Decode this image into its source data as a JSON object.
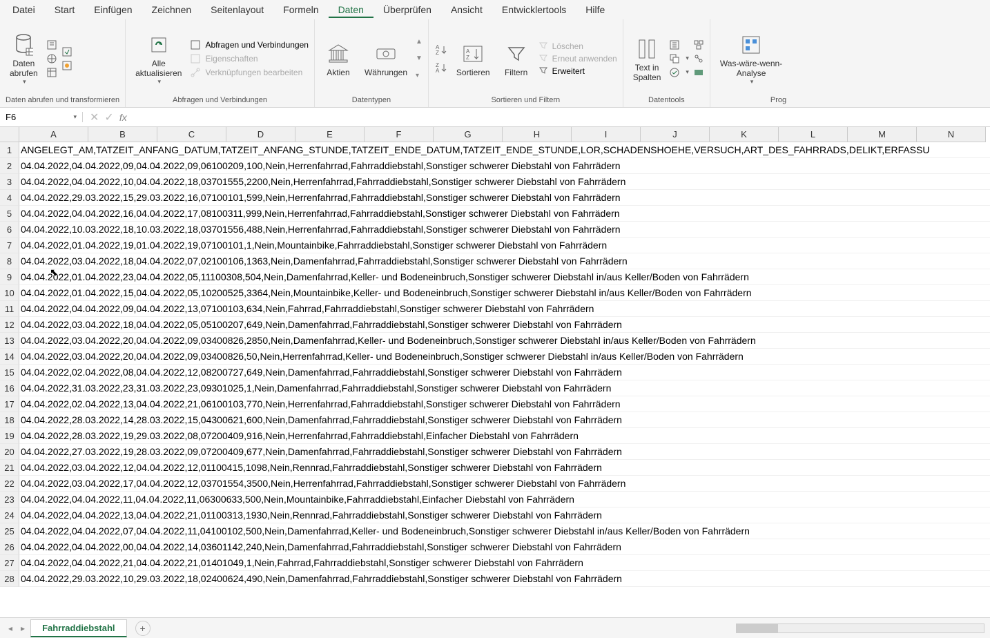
{
  "menu": {
    "items": [
      "Datei",
      "Start",
      "Einfügen",
      "Zeichnen",
      "Seitenlayout",
      "Formeln",
      "Daten",
      "Überprüfen",
      "Ansicht",
      "Entwicklertools",
      "Hilfe"
    ],
    "active_index": 6
  },
  "ribbon": {
    "groups": [
      {
        "name": "data-get-transform",
        "buttons": {
          "daten_abrufen": "Daten\nabrufen"
        },
        "label": "Daten abrufen und transformieren"
      },
      {
        "name": "queries-connections",
        "buttons": {
          "alle_aktualisieren": "Alle\naktualisieren",
          "abfragen": "Abfragen und Verbindungen",
          "eigenschaften": "Eigenschaften",
          "verknuepfungen": "Verknüpfungen bearbeiten"
        },
        "label": "Abfragen und Verbindungen"
      },
      {
        "name": "data-types",
        "buttons": {
          "aktien": "Aktien",
          "waehrungen": "Währungen"
        },
        "label": "Datentypen"
      },
      {
        "name": "sort-filter",
        "buttons": {
          "sortieren": "Sortieren",
          "filtern": "Filtern",
          "loeschen": "Löschen",
          "erneut": "Erneut anwenden",
          "erweitert": "Erweitert"
        },
        "label": "Sortieren und Filtern"
      },
      {
        "name": "data-tools",
        "buttons": {
          "text_in_spalten": "Text in\nSpalten"
        },
        "label": "Datentools"
      },
      {
        "name": "forecast",
        "buttons": {
          "was_waere": "Was-wäre-wenn-\nAnalyse"
        },
        "label": "Prog"
      }
    ]
  },
  "name_box": "F6",
  "formula": "",
  "columns": [
    "A",
    "B",
    "C",
    "D",
    "E",
    "F",
    "G",
    "H",
    "I",
    "J",
    "K",
    "L",
    "M",
    "N"
  ],
  "rows": [
    {
      "n": 1,
      "text": "ANGELEGT_AM,TATZEIT_ANFANG_DATUM,TATZEIT_ANFANG_STUNDE,TATZEIT_ENDE_DATUM,TATZEIT_ENDE_STUNDE,LOR,SCHADENSHOEHE,VERSUCH,ART_DES_FAHRRADS,DELIKT,ERFASSU"
    },
    {
      "n": 2,
      "text": "04.04.2022,04.04.2022,09,04.04.2022,09,06100209,100,Nein,Herrenfahrrad,Fahrraddiebstahl,Sonstiger schwerer Diebstahl von Fahrrädern"
    },
    {
      "n": 3,
      "text": "04.04.2022,04.04.2022,10,04.04.2022,18,03701555,2200,Nein,Herrenfahrrad,Fahrraddiebstahl,Sonstiger schwerer Diebstahl von Fahrrädern"
    },
    {
      "n": 4,
      "text": "04.04.2022,29.03.2022,15,29.03.2022,16,07100101,599,Nein,Herrenfahrrad,Fahrraddiebstahl,Sonstiger schwerer Diebstahl von Fahrrädern"
    },
    {
      "n": 5,
      "text": "04.04.2022,04.04.2022,16,04.04.2022,17,08100311,999,Nein,Herrenfahrrad,Fahrraddiebstahl,Sonstiger schwerer Diebstahl von Fahrrädern"
    },
    {
      "n": 6,
      "text": "04.04.2022,10.03.2022,18,10.03.2022,18,03701556,488,Nein,Herrenfahrrad,Fahrraddiebstahl,Sonstiger schwerer Diebstahl von Fahrrädern"
    },
    {
      "n": 7,
      "text": "04.04.2022,01.04.2022,19,01.04.2022,19,07100101,1,Nein,Mountainbike,Fahrraddiebstahl,Sonstiger schwerer Diebstahl von Fahrrädern"
    },
    {
      "n": 8,
      "text": "04.04.2022,03.04.2022,18,04.04.2022,07,02100106,1363,Nein,Damenfahrrad,Fahrraddiebstahl,Sonstiger schwerer Diebstahl von Fahrrädern"
    },
    {
      "n": 9,
      "text": "04.04.2022,01.04.2022,23,04.04.2022,05,11100308,504,Nein,Damenfahrrad,Keller- und Bodeneinbruch,Sonstiger schwerer Diebstahl in/aus Keller/Boden von Fahrrädern"
    },
    {
      "n": 10,
      "text": "04.04.2022,01.04.2022,15,04.04.2022,05,10200525,3364,Nein,Mountainbike,Keller- und Bodeneinbruch,Sonstiger schwerer Diebstahl in/aus Keller/Boden von Fahrrädern"
    },
    {
      "n": 11,
      "text": "04.04.2022,04.04.2022,09,04.04.2022,13,07100103,634,Nein,Fahrrad,Fahrraddiebstahl,Sonstiger schwerer Diebstahl von Fahrrädern"
    },
    {
      "n": 12,
      "text": "04.04.2022,03.04.2022,18,04.04.2022,05,05100207,649,Nein,Damenfahrrad,Fahrraddiebstahl,Sonstiger schwerer Diebstahl von Fahrrädern"
    },
    {
      "n": 13,
      "text": "04.04.2022,03.04.2022,20,04.04.2022,09,03400826,2850,Nein,Damenfahrrad,Keller- und Bodeneinbruch,Sonstiger schwerer Diebstahl in/aus Keller/Boden von Fahrrädern"
    },
    {
      "n": 14,
      "text": "04.04.2022,03.04.2022,20,04.04.2022,09,03400826,50,Nein,Herrenfahrrad,Keller- und Bodeneinbruch,Sonstiger schwerer Diebstahl in/aus Keller/Boden von Fahrrädern"
    },
    {
      "n": 15,
      "text": "04.04.2022,02.04.2022,08,04.04.2022,12,08200727,649,Nein,Damenfahrrad,Fahrraddiebstahl,Sonstiger schwerer Diebstahl von Fahrrädern"
    },
    {
      "n": 16,
      "text": "04.04.2022,31.03.2022,23,31.03.2022,23,09301025,1,Nein,Damenfahrrad,Fahrraddiebstahl,Sonstiger schwerer Diebstahl von Fahrrädern"
    },
    {
      "n": 17,
      "text": "04.04.2022,02.04.2022,13,04.04.2022,21,06100103,770,Nein,Herrenfahrrad,Fahrraddiebstahl,Sonstiger schwerer Diebstahl von Fahrrädern"
    },
    {
      "n": 18,
      "text": "04.04.2022,28.03.2022,14,28.03.2022,15,04300621,600,Nein,Damenfahrrad,Fahrraddiebstahl,Sonstiger schwerer Diebstahl von Fahrrädern"
    },
    {
      "n": 19,
      "text": "04.04.2022,28.03.2022,19,29.03.2022,08,07200409,916,Nein,Herrenfahrrad,Fahrraddiebstahl,Einfacher Diebstahl von Fahrrädern"
    },
    {
      "n": 20,
      "text": "04.04.2022,27.03.2022,19,28.03.2022,09,07200409,677,Nein,Damenfahrrad,Fahrraddiebstahl,Sonstiger schwerer Diebstahl von Fahrrädern"
    },
    {
      "n": 21,
      "text": "04.04.2022,03.04.2022,12,04.04.2022,12,01100415,1098,Nein,Rennrad,Fahrraddiebstahl,Sonstiger schwerer Diebstahl von Fahrrädern"
    },
    {
      "n": 22,
      "text": "04.04.2022,03.04.2022,17,04.04.2022,12,03701554,3500,Nein,Herrenfahrrad,Fahrraddiebstahl,Sonstiger schwerer Diebstahl von Fahrrädern"
    },
    {
      "n": 23,
      "text": "04.04.2022,04.04.2022,11,04.04.2022,11,06300633,500,Nein,Mountainbike,Fahrraddiebstahl,Einfacher Diebstahl von Fahrrädern"
    },
    {
      "n": 24,
      "text": "04.04.2022,04.04.2022,13,04.04.2022,21,01100313,1930,Nein,Rennrad,Fahrraddiebstahl,Sonstiger schwerer Diebstahl von Fahrrädern"
    },
    {
      "n": 25,
      "text": "04.04.2022,04.04.2022,07,04.04.2022,11,04100102,500,Nein,Damenfahrrad,Keller- und Bodeneinbruch,Sonstiger schwerer Diebstahl in/aus Keller/Boden von Fahrrädern"
    },
    {
      "n": 26,
      "text": "04.04.2022,04.04.2022,00,04.04.2022,14,03601142,240,Nein,Damenfahrrad,Fahrraddiebstahl,Sonstiger schwerer Diebstahl von Fahrrädern"
    },
    {
      "n": 27,
      "text": "04.04.2022,04.04.2022,21,04.04.2022,21,01401049,1,Nein,Fahrrad,Fahrraddiebstahl,Sonstiger schwerer Diebstahl von Fahrrädern"
    },
    {
      "n": 28,
      "text": "04.04.2022,29.03.2022,10,29.03.2022,18,02400624,490,Nein,Damenfahrrad,Fahrraddiebstahl,Sonstiger schwerer Diebstahl von Fahrrädern"
    }
  ],
  "sheet_tab": "Fahrraddiebstahl"
}
